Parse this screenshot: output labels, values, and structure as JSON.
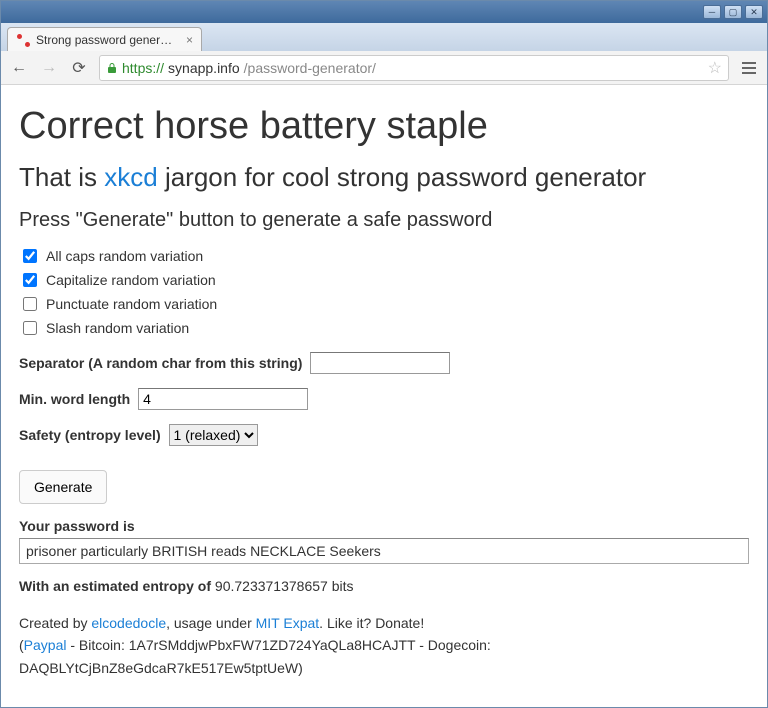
{
  "window": {
    "tab_title": "Strong password generator"
  },
  "url": {
    "scheme": "https://",
    "host": "synapp.info",
    "path": "/password-generator/"
  },
  "page": {
    "h1": "Correct horse battery staple",
    "h2_prefix": "That is ",
    "h2_link": "xkcd",
    "h2_suffix": " jargon for cool strong password generator",
    "instruction": "Press \"Generate\" button to generate a safe password"
  },
  "options": {
    "allcaps": {
      "label": "All caps random variation",
      "checked": true
    },
    "capitalize": {
      "label": "Capitalize random variation",
      "checked": true
    },
    "punctuate": {
      "label": "Punctuate random variation",
      "checked": false
    },
    "slash": {
      "label": "Slash random variation",
      "checked": false
    }
  },
  "separator": {
    "label": "Separator (A random char from this string)",
    "value": ""
  },
  "min_word_length": {
    "label": "Min. word length",
    "value": "4"
  },
  "safety": {
    "label": "Safety (entropy level)",
    "selected": "1 (relaxed)",
    "options": [
      "1 (relaxed)"
    ]
  },
  "generate_label": "Generate",
  "result": {
    "label": "Your password is",
    "value": "prisoner particularly BRITISH reads NECKLACE Seekers"
  },
  "entropy": {
    "label": "With an estimated entropy of",
    "value": "90.723371378657",
    "unit": "bits"
  },
  "footer": {
    "created_by": "Created by ",
    "author": "elcodedocle",
    "usage_under": ", usage under ",
    "license": "MIT Expat",
    "like_it": ". Like it? Donate!",
    "open_paren": "(",
    "paypal": "Paypal",
    "btc_prefix": " - Bitcoin: ",
    "btc": "1A7rSMddjwPbxFW71ZD724YaQLa8HCAJTT",
    "doge_prefix": " - Dogecoin: ",
    "doge": "DAQBLYtCjBnZ8eGdcaR7kE517Ew5tptUeW",
    "close_paren": ")"
  }
}
